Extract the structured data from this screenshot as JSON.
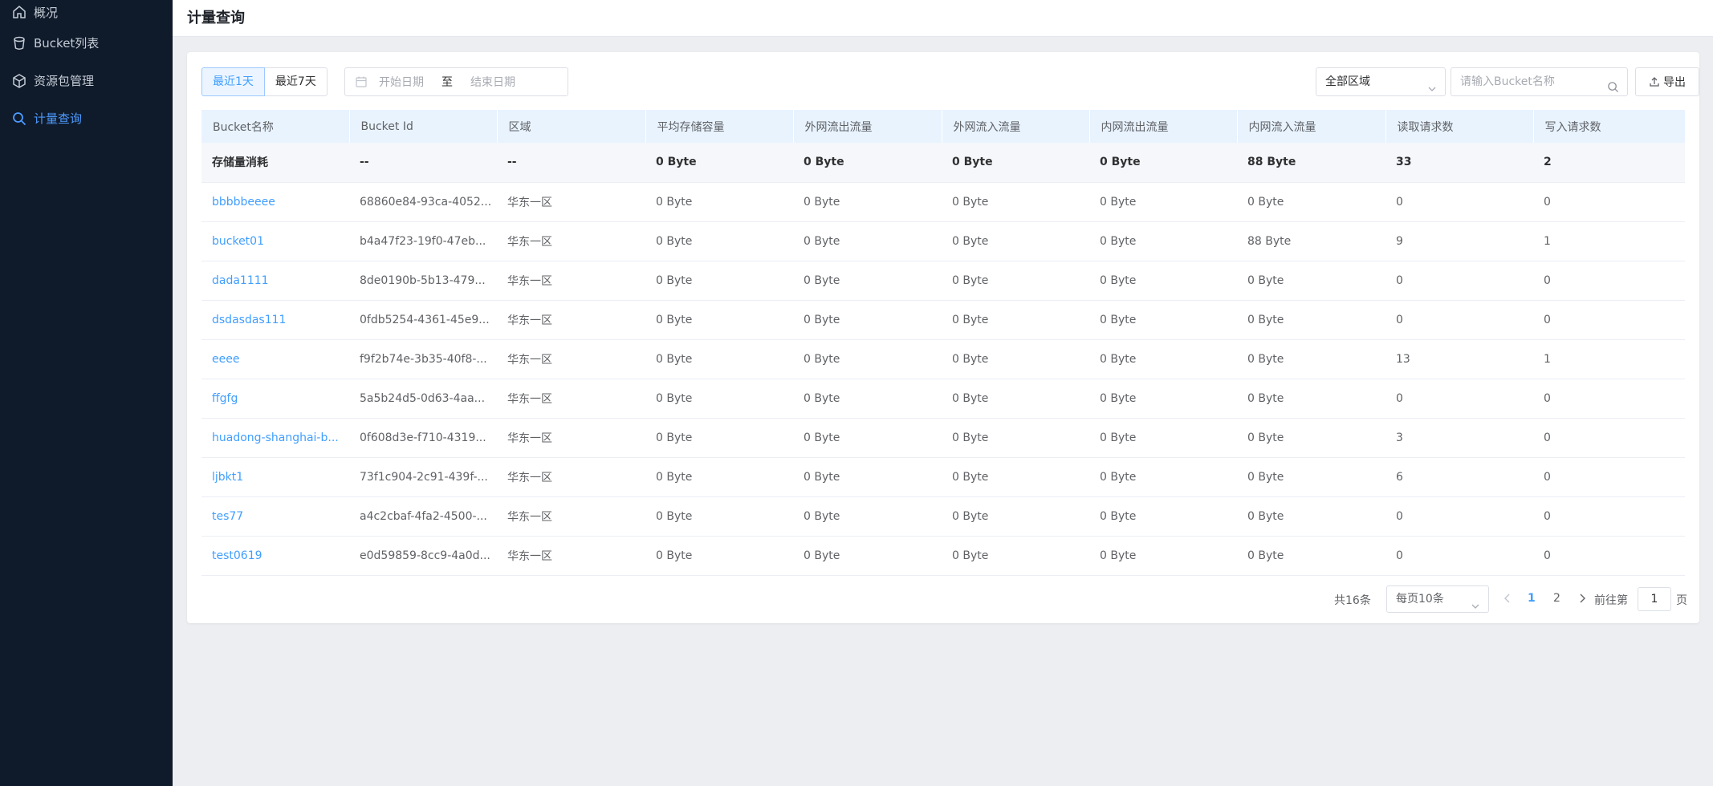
{
  "sidebar": {
    "items": [
      {
        "label": "概况",
        "icon": "home-icon",
        "active": false
      },
      {
        "label": "Bucket列表",
        "icon": "bucket-icon",
        "active": false
      },
      {
        "label": "资源包管理",
        "icon": "package-icon",
        "active": false
      },
      {
        "label": "计量查询",
        "icon": "search-icon",
        "active": true
      }
    ]
  },
  "header": {
    "title": "计量查询"
  },
  "toolbar": {
    "range_1day": "最近1天",
    "range_7day": "最近7天",
    "start_placeholder": "开始日期",
    "range_separator": "至",
    "end_placeholder": "结束日期",
    "region_value": "全部区域",
    "search_placeholder": "请输入Bucket名称",
    "export_label": "导出"
  },
  "table": {
    "columns": [
      "Bucket名称",
      "Bucket Id",
      "区域",
      "平均存储容量",
      "外网流出流量",
      "外网流入流量",
      "内网流出流量",
      "内网流入流量",
      "读取请求数",
      "写入请求数"
    ],
    "summary": [
      "存储量消耗",
      "--",
      "--",
      "0 Byte",
      "0 Byte",
      "0 Byte",
      "0 Byte",
      "88 Byte",
      "33",
      "2"
    ],
    "rows": [
      [
        "bbbbbeeee",
        "68860e84-93ca-4052...",
        "华东一区",
        "0 Byte",
        "0 Byte",
        "0 Byte",
        "0 Byte",
        "0 Byte",
        "0",
        "0"
      ],
      [
        "bucket01",
        "b4a47f23-19f0-47eb...",
        "华东一区",
        "0 Byte",
        "0 Byte",
        "0 Byte",
        "0 Byte",
        "88 Byte",
        "9",
        "1"
      ],
      [
        "dada1111",
        "8de0190b-5b13-479...",
        "华东一区",
        "0 Byte",
        "0 Byte",
        "0 Byte",
        "0 Byte",
        "0 Byte",
        "0",
        "0"
      ],
      [
        "dsdasdas111",
        "0fdb5254-4361-45e9...",
        "华东一区",
        "0 Byte",
        "0 Byte",
        "0 Byte",
        "0 Byte",
        "0 Byte",
        "0",
        "0"
      ],
      [
        "eeee",
        "f9f2b74e-3b35-40f8-...",
        "华东一区",
        "0 Byte",
        "0 Byte",
        "0 Byte",
        "0 Byte",
        "0 Byte",
        "13",
        "1"
      ],
      [
        "ffgfg",
        "5a5b24d5-0d63-4aa...",
        "华东一区",
        "0 Byte",
        "0 Byte",
        "0 Byte",
        "0 Byte",
        "0 Byte",
        "0",
        "0"
      ],
      [
        "huadong-shanghai-b...",
        "0f608d3e-f710-4319...",
        "华东一区",
        "0 Byte",
        "0 Byte",
        "0 Byte",
        "0 Byte",
        "0 Byte",
        "3",
        "0"
      ],
      [
        "ljbkt1",
        "73f1c904-2c91-439f-...",
        "华东一区",
        "0 Byte",
        "0 Byte",
        "0 Byte",
        "0 Byte",
        "0 Byte",
        "6",
        "0"
      ],
      [
        "tes77",
        "a4c2cbaf-4fa2-4500-...",
        "华东一区",
        "0 Byte",
        "0 Byte",
        "0 Byte",
        "0 Byte",
        "0 Byte",
        "0",
        "0"
      ],
      [
        "test0619",
        "e0d59859-8cc9-4a0d...",
        "华东一区",
        "0 Byte",
        "0 Byte",
        "0 Byte",
        "0 Byte",
        "0 Byte",
        "0",
        "0"
      ]
    ]
  },
  "pagination": {
    "total": "共16条",
    "page_size": "每页10条",
    "pages": [
      "1",
      "2"
    ],
    "current": "1",
    "goto_label": "前往第",
    "goto_value": "1",
    "page_unit": "页"
  },
  "colors": {
    "accent": "#409eff",
    "sidebar_bg": "#0f1a2a",
    "header_bg": "#e8f3fe"
  }
}
